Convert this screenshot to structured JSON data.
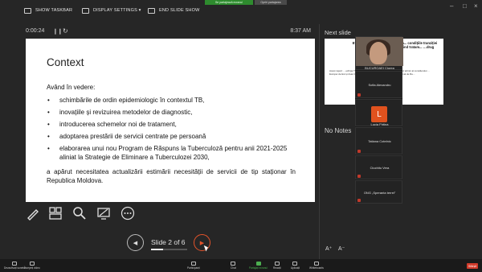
{
  "topbar": {
    "show_taskbar": "SHOW TASKBAR",
    "display_settings": "DISPLAY SETTINGS ▾",
    "end_slide_show": "END SLIDE SHOW",
    "sharing_text": "Se partajează ecranul",
    "sharing_extra": "Opriri partajarea"
  },
  "timer": {
    "elapsed": "0:00:24",
    "clock": "8:37 AM"
  },
  "slide": {
    "title": "Context",
    "intro": "Având în vedere:",
    "bullets": [
      "schimbările de ordin epidemiologic în contextul TB,",
      "inovațiile și revizuirea metodelor de diagnostic,",
      "introducerea schemelor noi de tratament,",
      "adoptarea prestării de servicii centrate pe persoană",
      "elaborarea unui nou Program de Răspuns la Tuberculoză pentru anii 2021-2025 aliniat la Strategie de Eliminare a Tuberculozei 2030,"
    ],
    "paragraph": "a apărut necesitatea actualizării estimării necesității de servicii de tip staționar în Republica Moldova."
  },
  "navigation": {
    "label": "Slide 2 of 6",
    "current": 2,
    "total": 6,
    "progress": 0.33
  },
  "next_slide": {
    "label": "Next slide",
    "title": "Evalu... ți specializată de stațion... condițiile tranziției epidem... …for OMS 2021 privind tratam... …drug rezistente",
    "body": "Acest raport ... echipa TB REP 2.0 a Țărmului pentru ... ei, cu suportul tehnic al consilierului ... Europei de Est și Asiei Centrale a P... parteneriat cu Programul Național de Re..."
  },
  "notes": {
    "label": "No Notes"
  },
  "font_controls": {
    "increase": "A⁺",
    "decrease": "A⁻"
  },
  "participants": [
    {
      "name": "BUCUROAEI Ciurea"
    },
    {
      "name": "Sofia Alexandru"
    },
    {
      "name": "Lucia Pirtina",
      "initial": "L"
    },
    {
      "name": "Tatiana Cotelnic"
    },
    {
      "name": "Ciuchitu Vera"
    },
    {
      "name": "ONG „Speranta terrei”"
    }
  ],
  "bottombar": {
    "items": [
      "Dezactivați sunetul",
      "Începeți video",
      "Participanți",
      "Chat",
      "Partajați ecranul",
      "Reacții",
      "Aplicații",
      "Whiteboards"
    ],
    "end": "Sfârșit"
  },
  "colors": {
    "next_button": "#e4532a",
    "end_button": "#d23b2b",
    "share_active": "#4caf50"
  }
}
